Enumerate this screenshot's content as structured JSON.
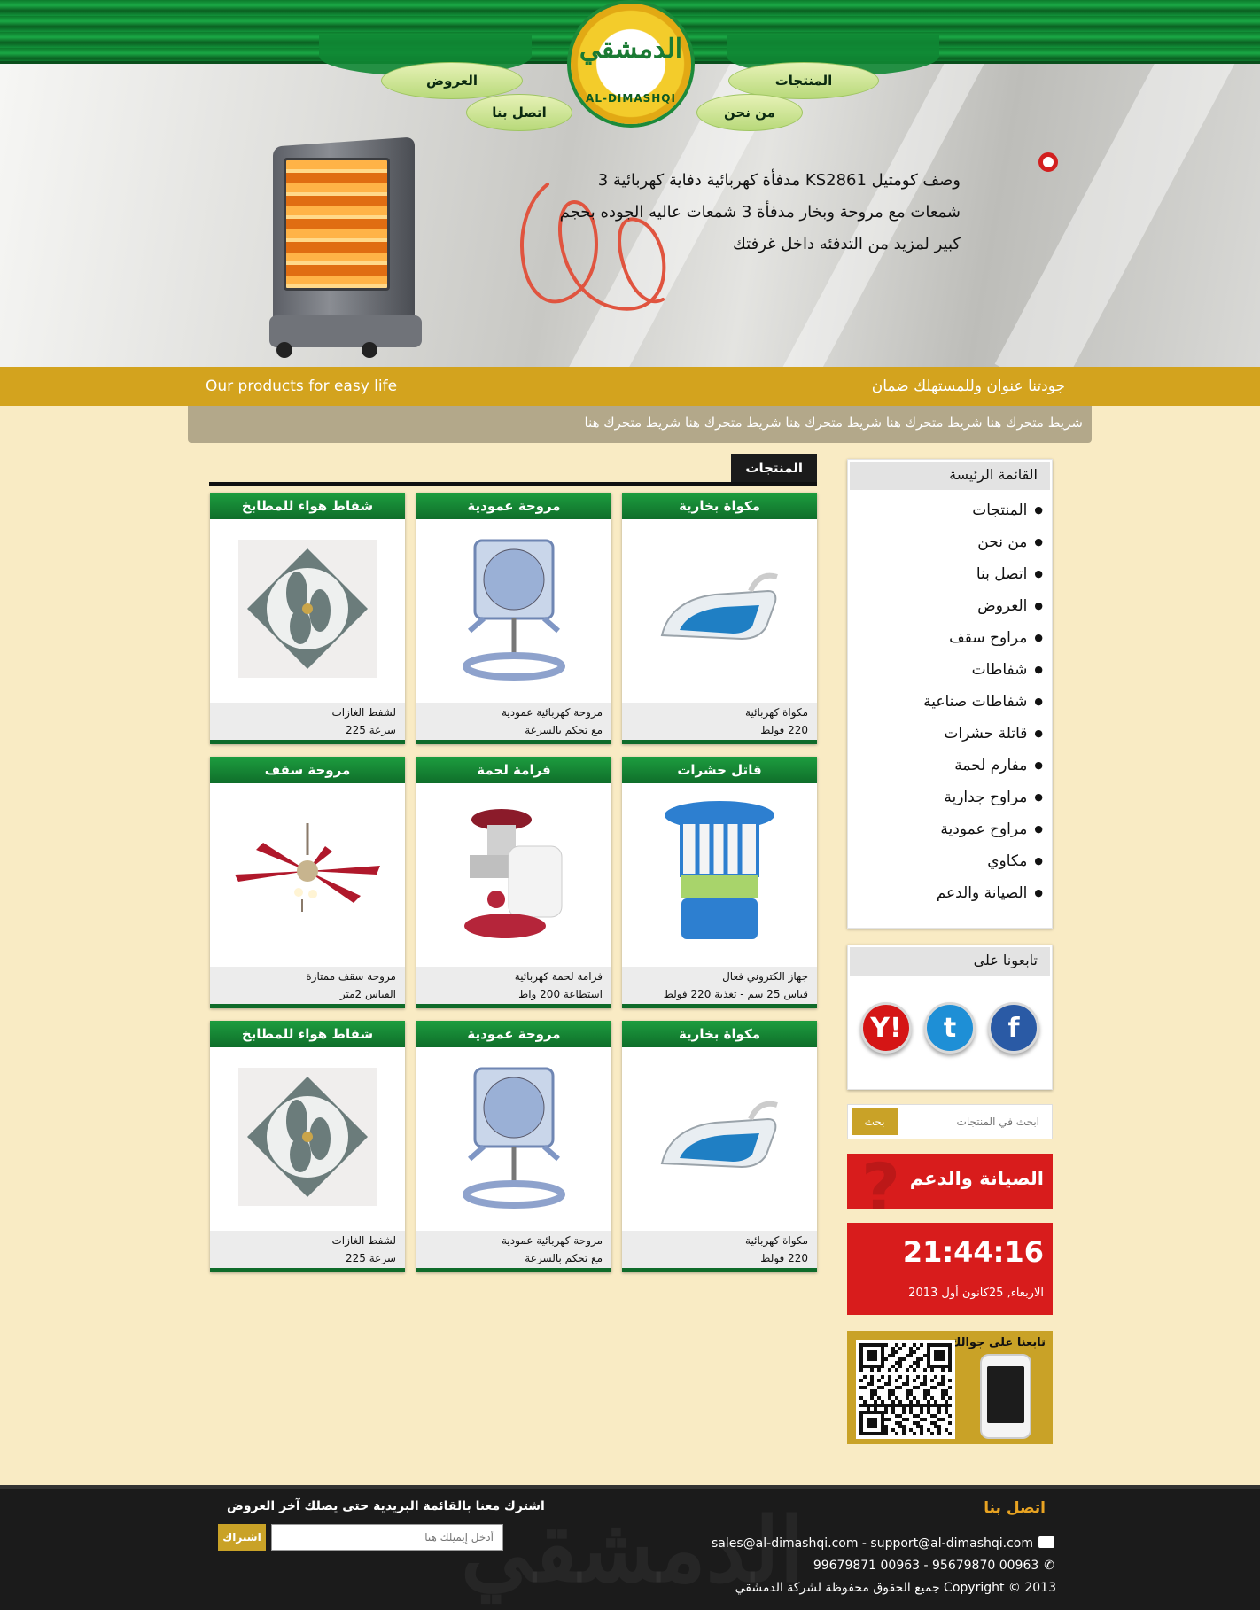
{
  "brand": {
    "name_ar": "الدمشقي",
    "name_en": "AL-DIMASHQI"
  },
  "nav": {
    "products": "المنتجات",
    "about": "من نحن",
    "offers": "العروض",
    "contact": "اتصل بنا"
  },
  "hero": {
    "line1": "وصف كومتيل KS2861 مدفأة كهربائية دفاية كهربائية 3",
    "line2": "شمعات مع مروحة وبخار مدفأة 3 شمعات عاليه الجوده بحجم",
    "line3": "كبير لمزيد من التدفئه داخل غرفتك"
  },
  "tagline": {
    "ar": "جودتنا عنوان وللمستهلك ضمان",
    "en": "Our products for easy life"
  },
  "ticker": "شريط متحرك هنا شريط متحرك هنا شريط متحرك هنا شريط متحرك هنا شريط متحرك هنا",
  "products_heading": "المنتجات",
  "products": [
    {
      "title": "مكواة بخارية",
      "line1": "مكواة كهربائية",
      "line2": "220 فولط",
      "icon": "steam-iron"
    },
    {
      "title": "مروحة عمودية",
      "line1": "مروحة كهربائية عمودية",
      "line2": "مع تحكم بالسرعة",
      "icon": "box-fan"
    },
    {
      "title": "شفاط هواء للمطابخ",
      "line1": "لشفط الغازات",
      "line2": "سرعة 225",
      "icon": "exhaust-fan"
    },
    {
      "title": "قاتل حشرات",
      "line1": "جهاز الكتروني فعال",
      "line2": "قياس 25 سم - تغذية 220 فولط",
      "icon": "insect-killer"
    },
    {
      "title": "فرامة لحمة",
      "line1": "فرامة لحمة كهربائية",
      "line2": "استطاعة 200 واط",
      "icon": "meat-grinder"
    },
    {
      "title": "مروحة سقف",
      "line1": "مروحة سقف ممتازة",
      "line2": "القياس 2متر",
      "icon": "ceiling-fan"
    },
    {
      "title": "مكواة بخارية",
      "line1": "مكواة كهربائية",
      "line2": "220 فولط",
      "icon": "steam-iron"
    },
    {
      "title": "مروحة عمودية",
      "line1": "مروحة كهربائية عمودية",
      "line2": "مع تحكم بالسرعة",
      "icon": "box-fan"
    },
    {
      "title": "شفاط هواء للمطابخ",
      "line1": "لشفط الغازات",
      "line2": "سرعة 225",
      "icon": "exhaust-fan"
    }
  ],
  "sidebar": {
    "menu_title": "القائمة الرئيسة",
    "menu": [
      "المنتجات",
      "من نحن",
      "اتصل بنا",
      "العروض",
      "مراوح سقف",
      "شفاطات",
      "شفاطات صناعية",
      "قاتلة حشرات",
      "مفارم لحمة",
      "مراوح جدارية",
      "مراوح عمودية",
      "مكاوي",
      "الصيانة والدعم"
    ],
    "follow_title": "تابعونا على",
    "social": [
      {
        "icon": "yahoo-icon",
        "glyph": "Y!",
        "color": "#d51515"
      },
      {
        "icon": "twitter-icon",
        "glyph": "t",
        "color": "#1e8fd6"
      },
      {
        "icon": "facebook-icon",
        "glyph": "f",
        "color": "#2a5aa5"
      }
    ],
    "search_button": "بحث",
    "search_placeholder": "ابحث في المنتجات",
    "maintenance": "الصيانة والدعم",
    "clock_time": "21:44:16",
    "clock_date": "الاربعاء, 25كانون أول 2013",
    "mobile_label": "تابعنا على جوالك"
  },
  "footer": {
    "contact_title": "اتصل بنا",
    "emails": "sales@al-dimashqi.com - support@al-dimashqi.com",
    "phones": "99679871 00963 - 95679870 00963",
    "copyright": "جميع الحقوق محفوظة لشركة الدمشقي Copyright © 2013",
    "newsletter_title": "اشترك معنا بالقائمة البريدية حتى يصلك آخر العروض",
    "newsletter_button": "اشتراك",
    "newsletter_placeholder": "أدخل إيميلك هنا"
  }
}
